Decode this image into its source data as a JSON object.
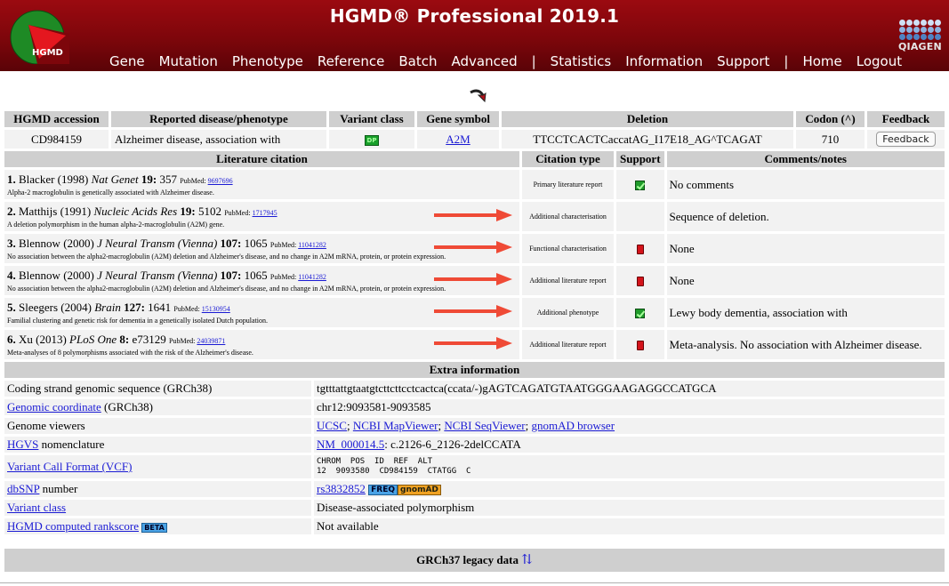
{
  "header": {
    "title": "HGMD® Professional 2019.1",
    "logo_text": "HGMD",
    "qiagen_text": "QIAGEN",
    "nav": {
      "gene": "Gene",
      "mutation": "Mutation",
      "phenotype": "Phenotype",
      "reference": "Reference",
      "batch": "Batch",
      "advanced": "Advanced",
      "sep1": "|",
      "statistics": "Statistics",
      "information": "Information",
      "support": "Support",
      "sep2": "|",
      "home": "Home",
      "logout": "Logout"
    }
  },
  "main": {
    "headers": {
      "accession": "HGMD accession",
      "disease": "Reported disease/phenotype",
      "variant_class": "Variant class",
      "gene_symbol": "Gene symbol",
      "deletion": "Deletion",
      "codon": "Codon (^)",
      "feedback": "Feedback"
    },
    "row": {
      "accession": "CD984159",
      "disease": "Alzheimer disease, association with",
      "variant_class": "DP",
      "gene_symbol": "A2M",
      "deletion": "TTCCTCACTCaccatAG_I17E18_AG^TCAGAT",
      "codon": "710",
      "feedback_button": "Feedback"
    }
  },
  "literature": {
    "headers": {
      "citation": "Literature citation",
      "type": "Citation type",
      "support": "Support",
      "comments": "Comments/notes"
    },
    "pubmed_label": "PubMed:",
    "rows": [
      {
        "num": "1.",
        "author": "Blacker (1998)",
        "journal": "Nat Genet",
        "vol": "19:",
        "page": "357",
        "pmid": "9697696",
        "title": "Alpha-2 macroglobulin is genetically associated with Alzheimer disease.",
        "type": "Primary literature report",
        "support": "green",
        "comment": "No comments"
      },
      {
        "num": "2.",
        "author": "Matthijs (1991)",
        "journal": "Nucleic Acids Res",
        "vol": "19:",
        "page": "5102",
        "pmid": "1717945",
        "title": "A deletion polymorphism in the human alpha-2-macroglobulin (A2M) gene.",
        "type": "Additional characterisation",
        "support": "",
        "comment": "Sequence of deletion."
      },
      {
        "num": "3.",
        "author": "Blennow (2000)",
        "journal": "J Neural Transm (Vienna)",
        "vol": "107:",
        "page": "1065",
        "pmid": "11041282",
        "title": "No association between the alpha2-macroglobulin (A2M) deletion and Alzheimer's disease, and no change in A2M mRNA, protein, or protein expression.",
        "type": "Functional characterisation",
        "support": "red",
        "comment": "None"
      },
      {
        "num": "4.",
        "author": "Blennow (2000)",
        "journal": "J Neural Transm (Vienna)",
        "vol": "107:",
        "page": "1065",
        "pmid": "11041282",
        "title": "No association between the alpha2-macroglobulin (A2M) deletion and Alzheimer's disease, and no change in A2M mRNA, protein, or protein expression.",
        "type": "Additional literature report",
        "support": "red",
        "comment": "None"
      },
      {
        "num": "5.",
        "author": "Sleegers (2004)",
        "journal": "Brain",
        "vol": "127:",
        "page": "1641",
        "pmid": "15130954",
        "title": "Familial clustering and genetic risk for dementia in a genetically isolated Dutch population.",
        "type": "Additional phenotype",
        "support": "green",
        "comment": "Lewy body dementia, association with"
      },
      {
        "num": "6.",
        "author": "Xu (2013)",
        "journal": "PLoS One",
        "vol": "8:",
        "page": "e73129",
        "pmid": "24039871",
        "title": "Meta-analyses of 8 polymorphisms associated with the risk of the Alzheimer's disease.",
        "type": "Additional literature report",
        "support": "red",
        "comment": "Meta-analysis. No association with Alzheimer disease."
      }
    ]
  },
  "extra": {
    "header": "Extra information",
    "coding_label": "Coding strand genomic sequence (GRCh38)",
    "coding_value": "tgtttattgtaatgtcttcttcctcactca(ccata/-)gAGTCAGATGTAATGGGAAGAGGCCATGCA",
    "genomic_link": "Genomic coordinate",
    "genomic_suffix": " (GRCh38)",
    "genomic_value": "chr12:9093581-9093585",
    "viewers_label": "Genome viewers",
    "viewers": {
      "ucsc": "UCSC",
      "mapviewer": "NCBI MapViewer",
      "seqviewer": "NCBI SeqViewer",
      "gnomad": "gnomAD browser",
      "sep": "; "
    },
    "hgvs_link": "HGVS",
    "hgvs_suffix": " nomenclature",
    "hgvs_transcript": "NM_000014.5",
    "hgvs_value": ": c.2126-6_2126-2delCCATA",
    "vcf_link": "Variant Call Format (VCF)",
    "vcf_header": "CHROM  POS  ID  REF  ALT",
    "vcf_row": "12  9093580  CD984159  CTATGG  C",
    "dbsnp_link": "dbSNP",
    "dbsnp_suffix": " number",
    "dbsnp_value": "rs3832852",
    "freq_label": "FREQ",
    "gnomad_label": "gnomAD",
    "variant_class_link": "Variant class",
    "variant_class_value": "Disease-associated polymorphism",
    "rankscore_link": "HGMD computed rankscore",
    "beta_label": "BETA",
    "rankscore_value": "Not available"
  },
  "legacy": {
    "label": "GRCh37 legacy data",
    "toggle": "⇅"
  }
}
